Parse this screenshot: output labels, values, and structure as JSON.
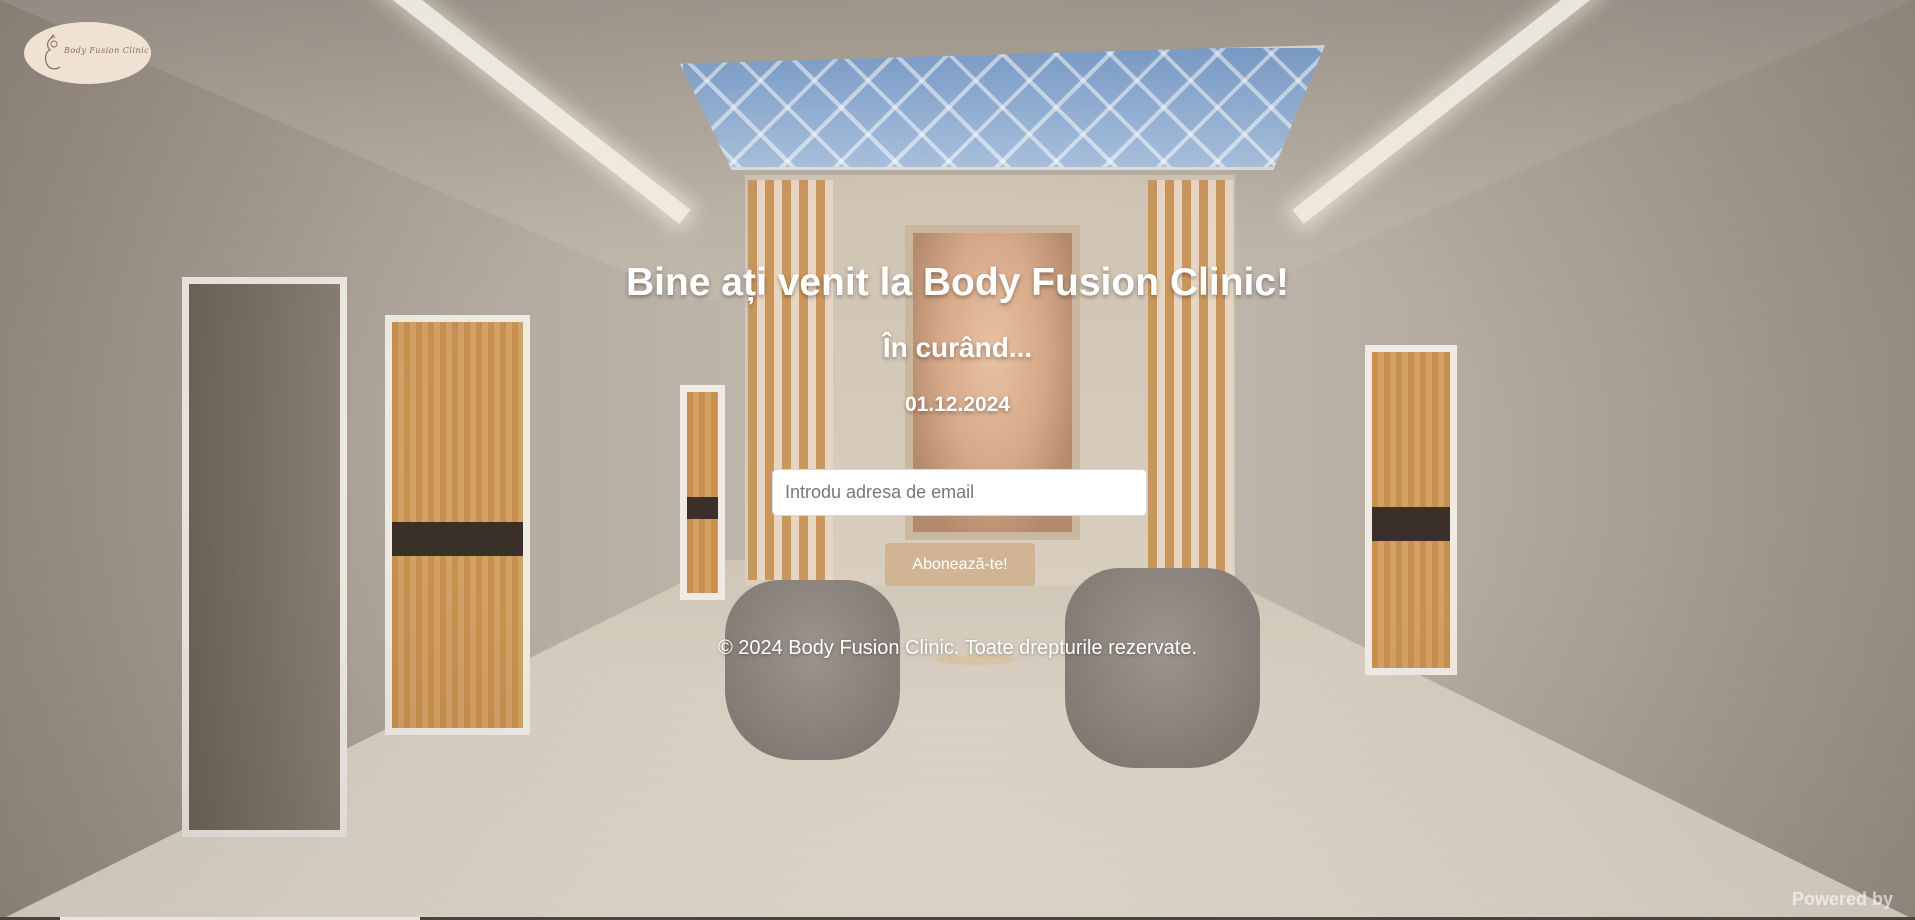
{
  "brand": {
    "logo_alt": "Body Fusion Clinic",
    "logo_text": "Body Fusion Clinic"
  },
  "hero": {
    "title": "Bine ați venit la Body Fusion Clinic!",
    "subtitle": "În curând...",
    "launch_date": "01.12.2024"
  },
  "subscribe": {
    "email_placeholder": "Introdu adresa de email",
    "email_value": "",
    "button_label": "Abonează-te!"
  },
  "footer": {
    "copyright": "© 2024 Body Fusion Clinic. Toate drepturile rezervate."
  },
  "badge": {
    "powered_by": "Powered by"
  },
  "colors": {
    "button_bg": "#d1b494",
    "text": "#ffffff",
    "logo_bg": "#efe2d3"
  }
}
